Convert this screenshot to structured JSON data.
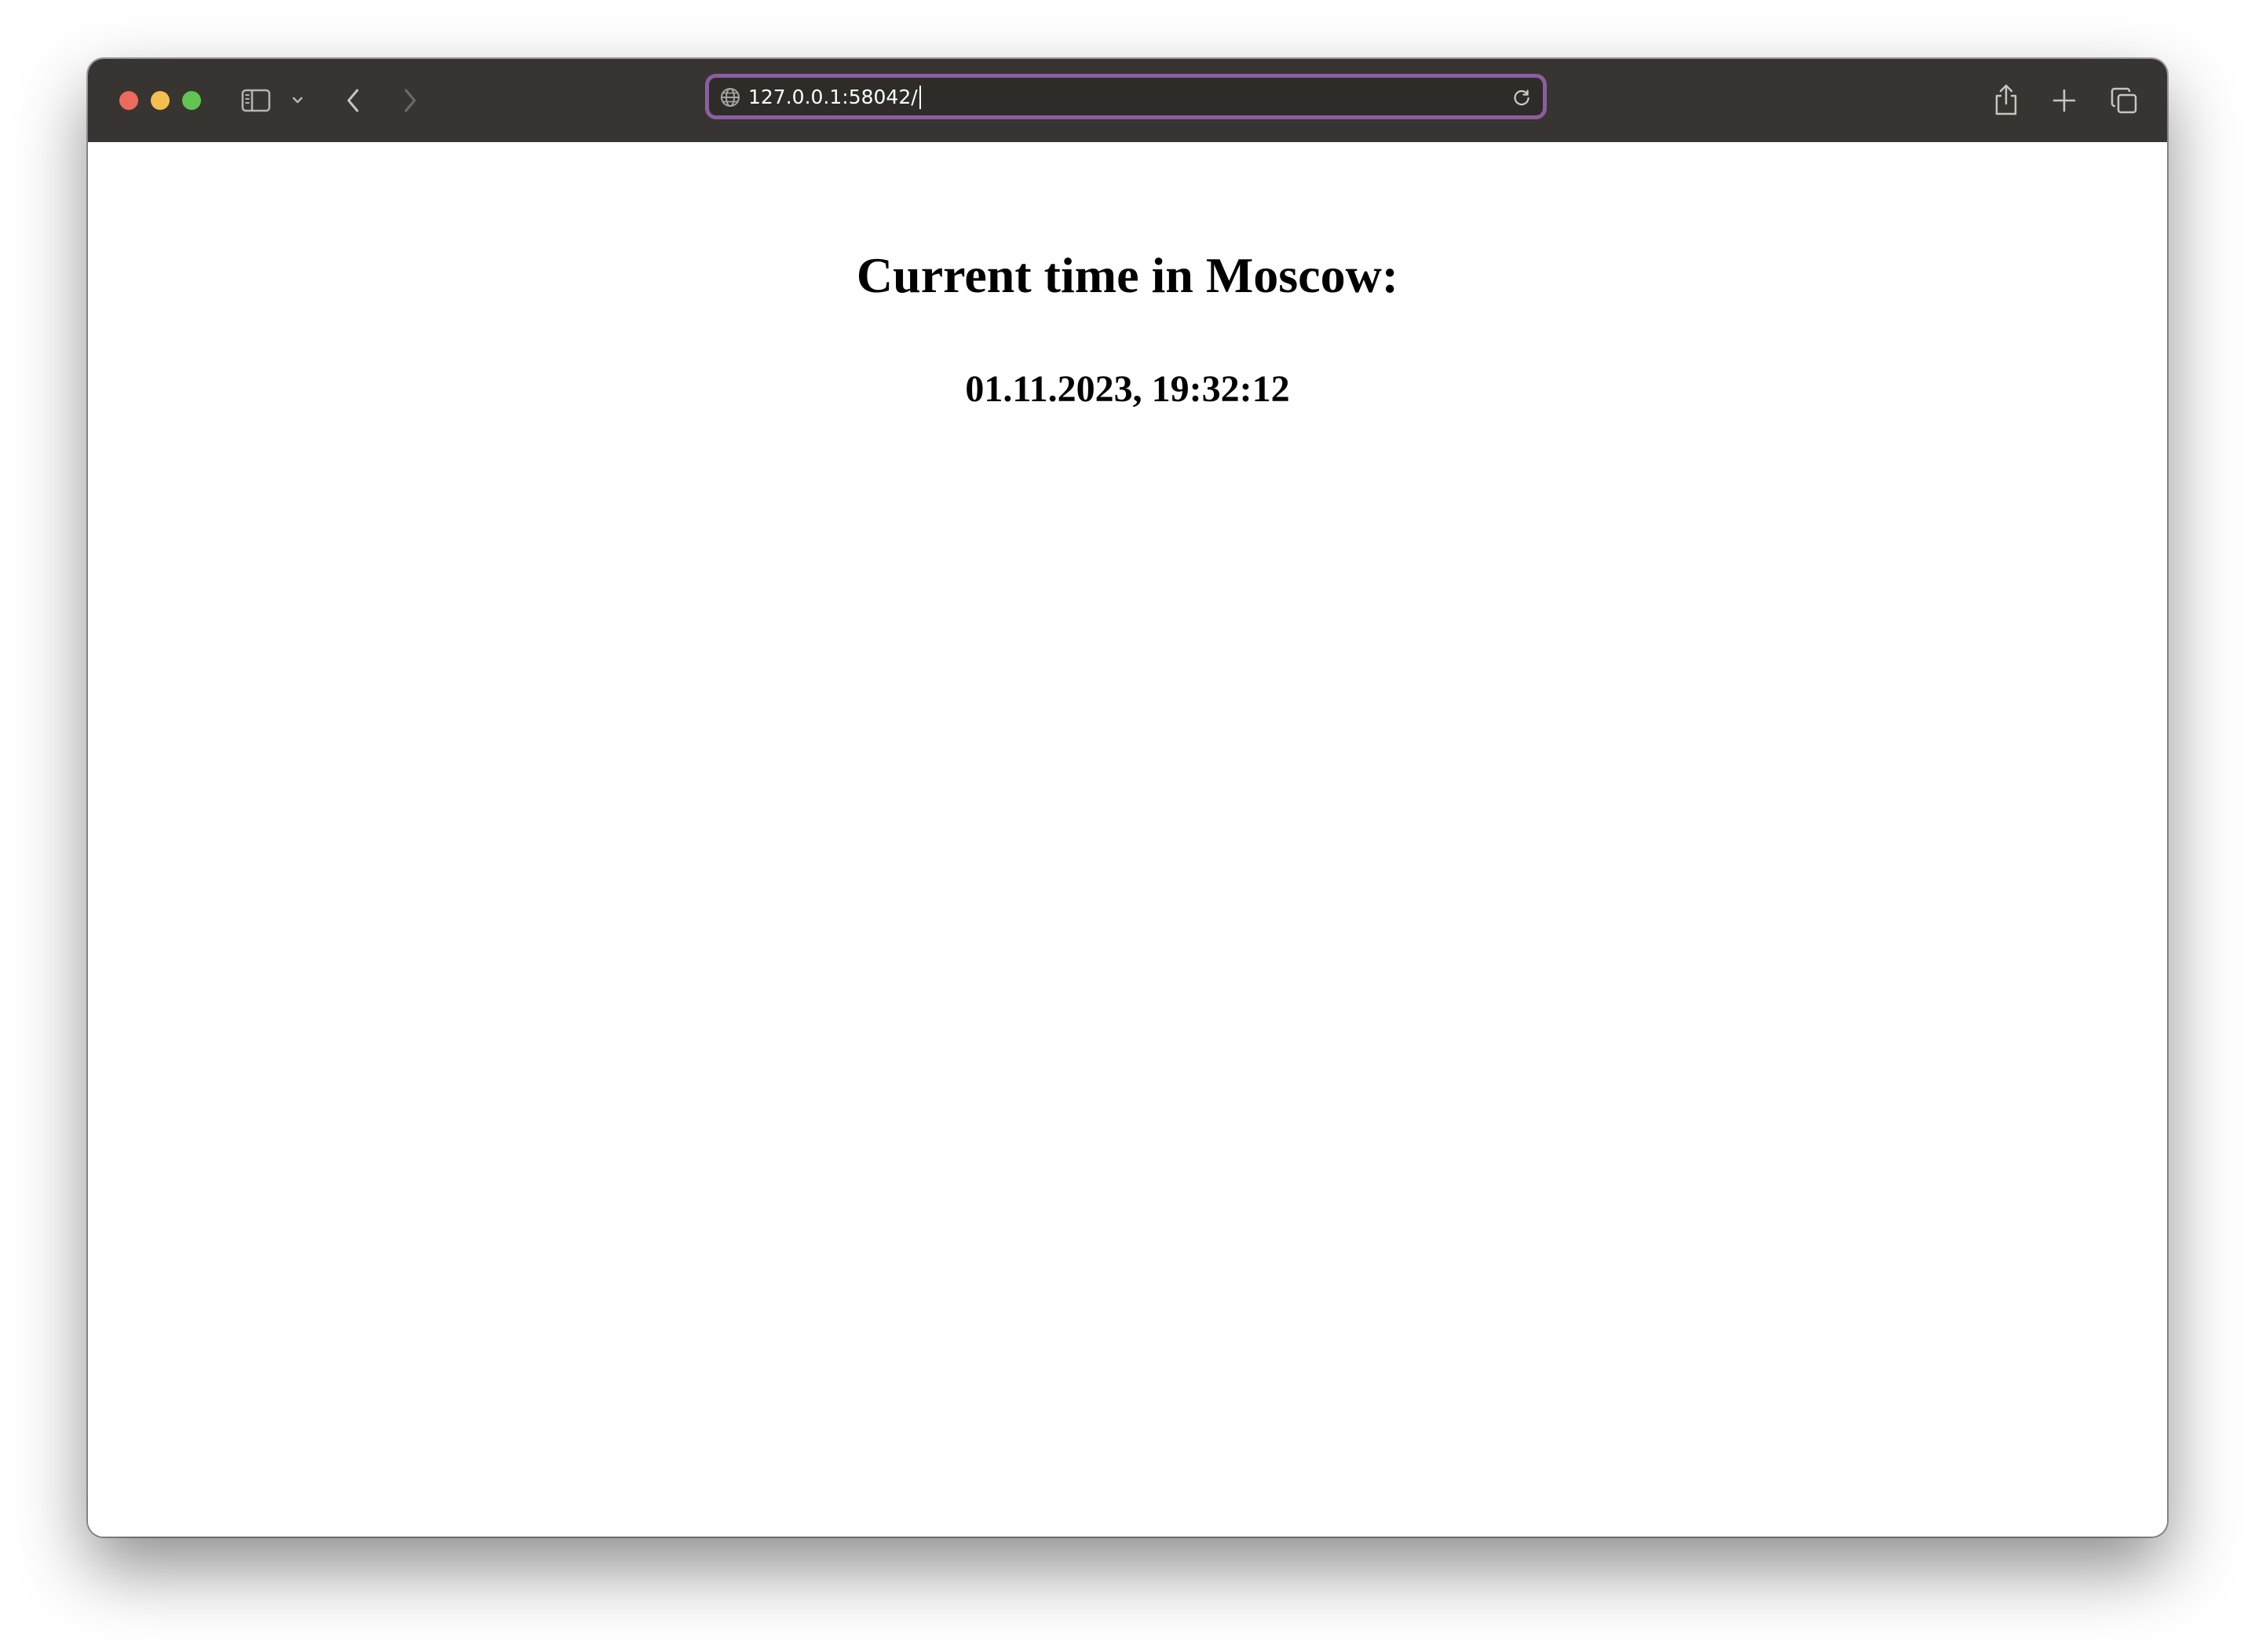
{
  "browser": {
    "address_bar": {
      "url": "127.0.0.1:58042/",
      "focused": true
    },
    "toolbar_icons": [
      "sidebar-icon",
      "chevron-down-icon",
      "back-icon",
      "forward-icon",
      "globe-icon",
      "reload-icon",
      "share-icon",
      "new-tab-icon",
      "tab-overview-icon"
    ]
  },
  "page": {
    "heading": "Current time in Moscow:",
    "time": "01.11.2023, 19:32:12"
  },
  "colors": {
    "toolbar_bg": "#383431",
    "address_focus_ring": "#8a5fa0",
    "traffic_close": "#ed6a5e",
    "traffic_minimize": "#f5bf4f",
    "traffic_maximize": "#61c554"
  }
}
